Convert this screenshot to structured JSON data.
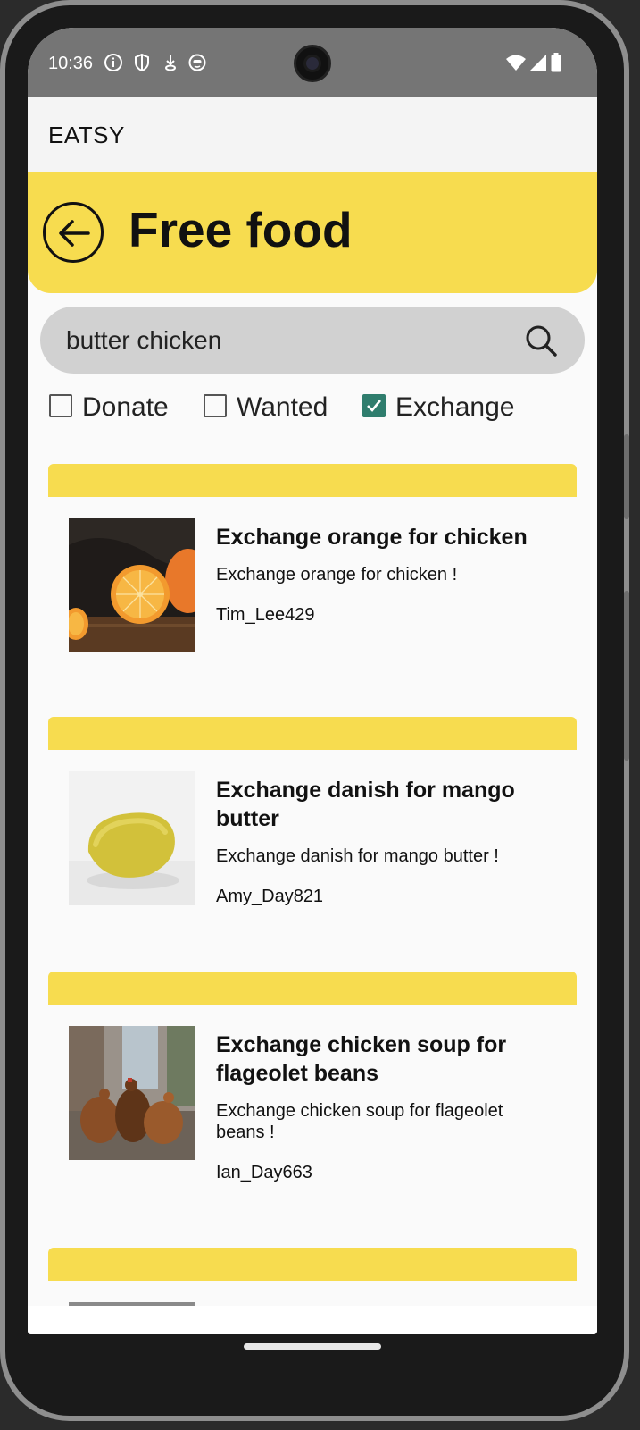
{
  "status_bar": {
    "time": "10:36",
    "left_icons": [
      "info-icon",
      "shield-icon",
      "download-icon",
      "face-icon"
    ],
    "right_icons": [
      "wifi-icon",
      "signal-icon",
      "battery-icon"
    ]
  },
  "app_bar": {
    "title": "EATSY"
  },
  "header": {
    "title": "Free food",
    "back_icon": "back-arrow-icon",
    "accent_color": "#f7dc4f"
  },
  "search": {
    "value": "butter chicken",
    "icon": "search-icon"
  },
  "filters": [
    {
      "label": "Donate",
      "checked": false
    },
    {
      "label": "Wanted",
      "checked": false
    },
    {
      "label": "Exchange",
      "checked": true
    }
  ],
  "listings": [
    {
      "title": "Exchange orange for chicken",
      "description": " Exchange orange for chicken !",
      "user": "Tim_Lee429",
      "image": "orange-photo"
    },
    {
      "title": "Exchange danish for mango butter",
      "description": " Exchange danish for mango butter !",
      "user": "Amy_Day821",
      "image": "mango-photo"
    },
    {
      "title": "Exchange chicken soup for flageolet beans",
      "description": " Exchange chicken soup for flageolet beans !",
      "user": "Ian_Day663",
      "image": "chickens-photo"
    }
  ]
}
